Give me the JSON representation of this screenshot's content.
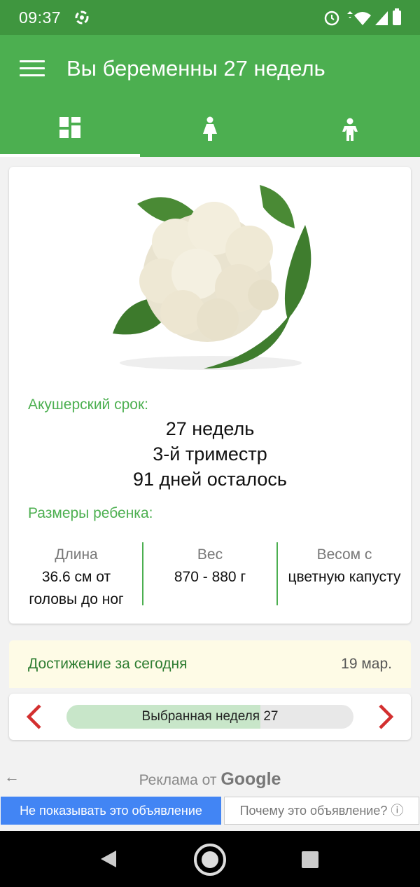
{
  "status_bar": {
    "time": "09:37"
  },
  "app_bar": {
    "title": "Вы беременны 27 недель",
    "tabs": [
      {
        "icon": "dashboard-icon",
        "active": true
      },
      {
        "icon": "woman-icon",
        "active": false
      },
      {
        "icon": "baby-icon",
        "active": false
      }
    ]
  },
  "card": {
    "term_label": "Акушерский срок:",
    "weeks": "27 недель",
    "trimester": "3-й триместр",
    "days_left": "91 дней осталось",
    "size_label": "Размеры ребенка:",
    "length_header": "Длина",
    "length_value_1": "36.6 см от",
    "length_value_2": "головы до ног",
    "weight_header": "Вес",
    "weight_value": "870 - 880 г",
    "compare_header": "Весом с",
    "compare_value": "цветную капусту"
  },
  "achievement": {
    "title": "Достижение за сегодня",
    "date": "19 мар."
  },
  "week_selector": {
    "label": "Выбранная неделя 27",
    "progress_fraction": 0.675
  },
  "ad": {
    "back_arrow": "←",
    "label_prefix": "Реклама от",
    "label_brand": "Google",
    "hide_button": "Не показывать это объявление",
    "why_button": "Почему это объявление? ⓘ"
  },
  "colors": {
    "status_bar": "#3f963f",
    "app_bar": "#4caf50",
    "accent_red": "#d32f2f"
  }
}
